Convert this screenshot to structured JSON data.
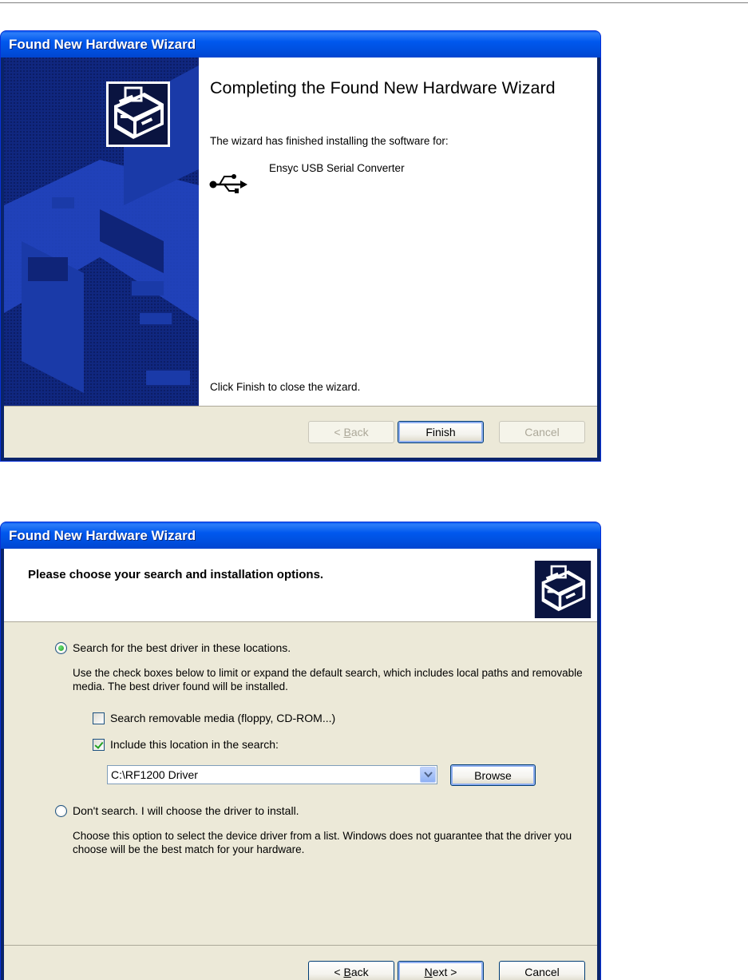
{
  "wizard1": {
    "title": "Found New Hardware Wizard",
    "heading": "Completing the Found New Hardware Wizard",
    "finished_text": "The wizard has finished installing the software for:",
    "device_name": "Ensyc USB Serial Converter",
    "close_hint": "Click Finish to close the wizard.",
    "buttons": {
      "back": "< Back",
      "finish": "Finish",
      "cancel": "Cancel"
    }
  },
  "wizard2": {
    "title": "Found New Hardware Wizard",
    "heading": "Please choose your search and installation options.",
    "option_search": {
      "label": "Search for the best driver in these locations.",
      "selected": true,
      "description": "Use the check boxes below to limit or expand the default search, which includes local paths and removable media. The best driver found will be installed."
    },
    "removable_media": {
      "label": "Search removable media (floppy, CD-ROM...)",
      "checked": false
    },
    "include_location": {
      "label": "Include this location in the search:",
      "checked": true
    },
    "location_value": "C:\\RF1200 Driver",
    "browse_label": "Browse",
    "option_dont_search": {
      "label": "Don't search. I will choose the driver to install.",
      "selected": false,
      "description": "Choose this option to select the device driver from a list.  Windows does not guarantee that the driver you choose will be the best match for your hardware."
    },
    "buttons": {
      "back": "< Back",
      "next": "Next >",
      "cancel": "Cancel"
    }
  },
  "icons": [
    "hardware-wizard-icon",
    "usb-icon",
    "dropdown-arrow-icon"
  ]
}
